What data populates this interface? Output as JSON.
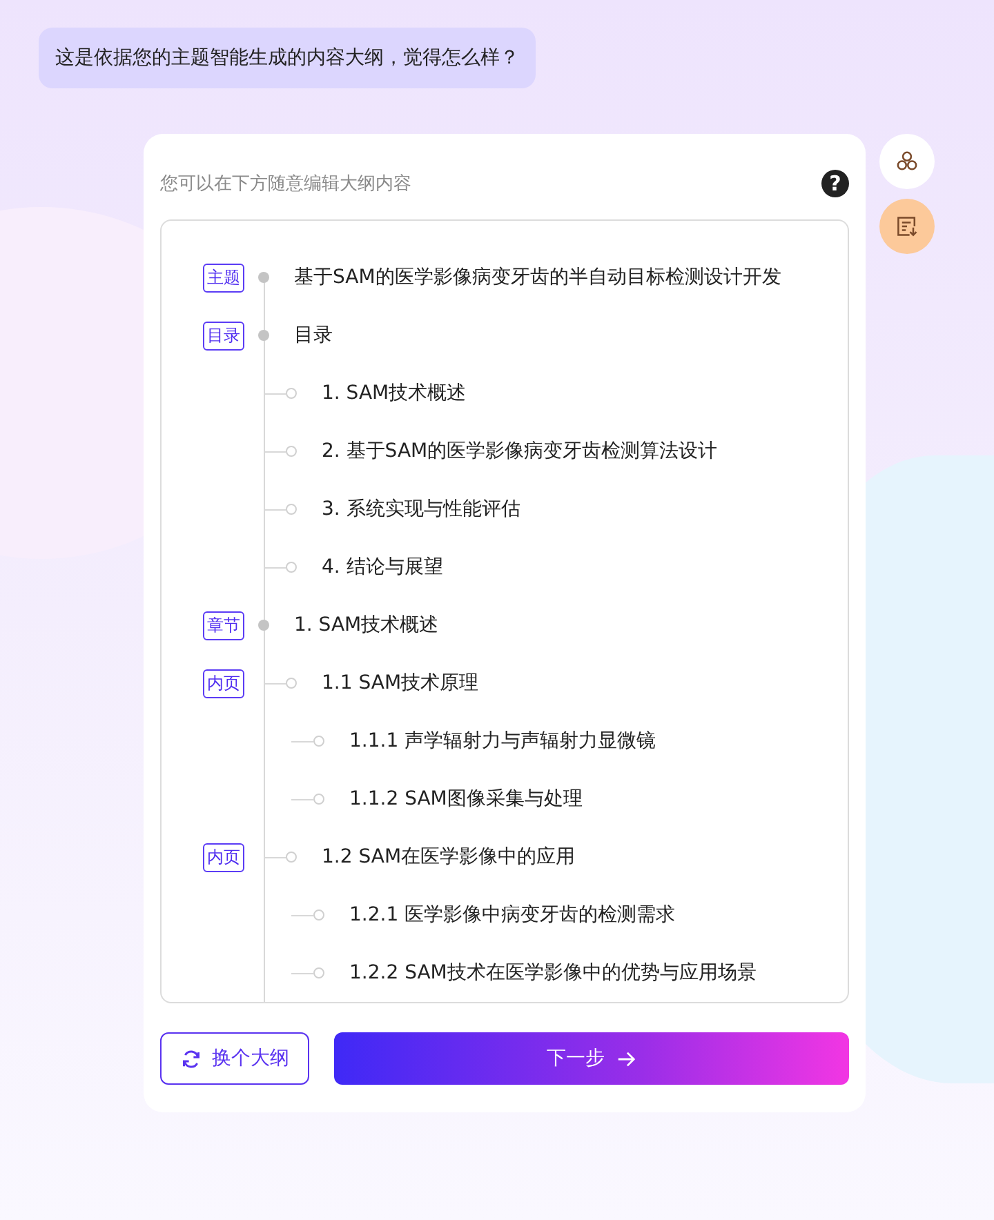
{
  "chat_bubble": {
    "text": "这是依据您的主题智能生成的内容大纲，觉得怎么样？"
  },
  "card": {
    "hint": "您可以在下方随意编辑大纲内容",
    "help_icon": "?"
  },
  "outline": [
    {
      "tag": "主题",
      "text": "基于SAM的医学影像病变牙齿的半自动目标检测设计开发"
    },
    {
      "tag": "目录",
      "text": "目录",
      "children": [
        {
          "text": "1. SAM技术概述"
        },
        {
          "text": "2. 基于SAM的医学影像病变牙齿检测算法设计"
        },
        {
          "text": "3. 系统实现与性能评估"
        },
        {
          "text": "4. 结论与展望"
        }
      ]
    },
    {
      "tag": "章节",
      "text": "1. SAM技术概述",
      "children": [
        {
          "tag": "内页",
          "text": "1.1 SAM技术原理",
          "children": [
            {
              "text": "1.1.1 声学辐射力与声辐射力显微镜"
            },
            {
              "text": "1.1.2 SAM图像采集与处理"
            }
          ]
        },
        {
          "tag": "内页",
          "text": "1.2 SAM在医学影像中的应用",
          "children": [
            {
              "text": "1.2.1 医学影像中病变牙齿的检测需求"
            },
            {
              "text": "1.2.2 SAM技术在医学影像中的优势与应用场景"
            }
          ]
        }
      ]
    }
  ],
  "buttons": [
    {
      "kind": "secondary",
      "label": "换个大纲"
    },
    {
      "kind": "primary",
      "label": "下一步"
    }
  ]
}
